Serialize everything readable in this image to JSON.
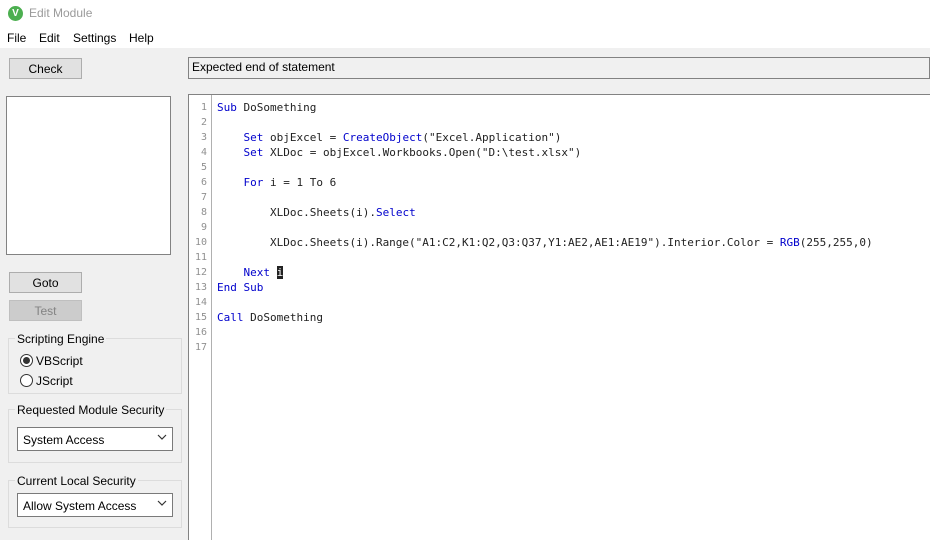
{
  "window": {
    "title": "Edit Module",
    "app_icon_letter": "V"
  },
  "menu": [
    "File",
    "Edit",
    "Settings",
    "Help"
  ],
  "buttons": {
    "check": "Check",
    "goto": "Goto",
    "test": "Test"
  },
  "status_message": "Expected end of statement",
  "scripting_engine": {
    "title": "Scripting Engine",
    "options": [
      "VBScript",
      "JScript"
    ],
    "selected": "VBScript"
  },
  "requested_module_security": {
    "title": "Requested Module Security",
    "value": "System Access"
  },
  "current_local_security": {
    "title": "Current Local Security",
    "value": "Allow System Access"
  },
  "code": {
    "line_numbers": [
      "1",
      "2",
      "3",
      "4",
      "5",
      "6",
      "7",
      "8",
      "9",
      "10",
      "11",
      "12",
      "13",
      "14",
      "15",
      "16",
      "17"
    ],
    "lines": [
      [
        {
          "t": "Sub",
          "k": 1
        },
        {
          "t": " DoSomething"
        }
      ],
      [],
      [
        {
          "t": "    "
        },
        {
          "t": "Set",
          "k": 1
        },
        {
          "t": " objExcel = "
        },
        {
          "t": "CreateObject",
          "k": 1
        },
        {
          "t": "(\"Excel.Application\")"
        }
      ],
      [
        {
          "t": "    "
        },
        {
          "t": "Set",
          "k": 1
        },
        {
          "t": " XLDoc = objExcel.Workbooks.Open(\"D:\\test.xlsx\")"
        }
      ],
      [],
      [
        {
          "t": "    "
        },
        {
          "t": "For",
          "k": 1
        },
        {
          "t": " i = 1 To 6"
        }
      ],
      [],
      [
        {
          "t": "        XLDoc.Sheets(i)."
        },
        {
          "t": "Select",
          "k": 1
        }
      ],
      [],
      [
        {
          "t": "        XLDoc.Sheets(i).Range(\"A1:C2,K1:Q2,Q3:Q37,Y1:AE2,AE1:AE19\").Interior.Color = "
        },
        {
          "t": "RGB",
          "k": 1
        },
        {
          "t": "(255,255,0)"
        }
      ],
      [],
      [
        {
          "t": "    "
        },
        {
          "t": "Next",
          "k": 1
        },
        {
          "t": " "
        },
        {
          "t": "i",
          "s": 1
        }
      ],
      [
        {
          "t": "End Sub",
          "k": 1
        }
      ],
      [],
      [
        {
          "t": "Call",
          "k": 1
        },
        {
          "t": " DoSomething"
        }
      ],
      [],
      []
    ]
  },
  "colors": {
    "keyword": "#0000cc",
    "background": "#f0f0f0",
    "editor_bg": "#ffffff"
  }
}
